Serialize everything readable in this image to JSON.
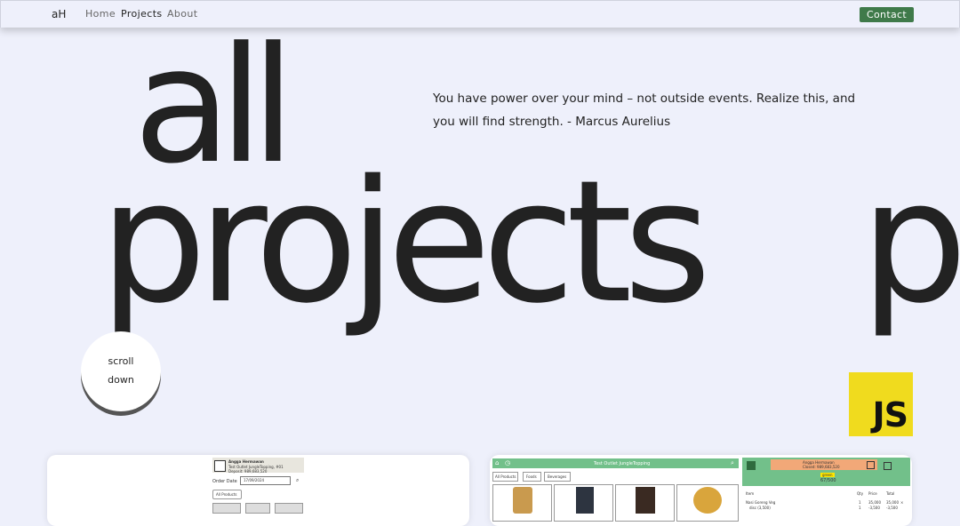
{
  "nav": {
    "logo": "aH",
    "links": [
      {
        "label": "Home",
        "active": false
      },
      {
        "label": "Projects",
        "active": true
      },
      {
        "label": "About",
        "active": false
      }
    ],
    "contact_label": "Contact",
    "contact_color": "#3f7a4a"
  },
  "hero": {
    "word_all": "all",
    "word_projects": "projects",
    "word_partial": "p",
    "quote": "You have power over your mind – not outside events. Realize this, and you will find strength. - Marcus Aurelius"
  },
  "scroll": {
    "line1": "scroll",
    "line2": "down"
  },
  "tech_badge": {
    "label": "JS",
    "color": "#f0db1e",
    "icon": "javascript-logo-icon"
  },
  "project1": {
    "user_name": "Angga Hermawan",
    "user_sub": "Test Outlet JungleTopping, #01",
    "user_deposit": "Deposit: 989,683,520",
    "order_date_label": "Order Date",
    "order_date_value": "17/09/2024",
    "all_products": "All Products"
  },
  "project2": {
    "header_title": "Test Outlet JungleTopping",
    "tabs": [
      "All Products",
      "Foods",
      "Beverages"
    ],
    "user_name": "Angga Hermawan",
    "user_sub": "Closed: 989,683,520",
    "badge": "green",
    "count": "67/500",
    "cols": [
      "Item",
      "Qty",
      "Price",
      "Total"
    ],
    "rows": [
      [
        "Nasi Goreng Veg",
        "1",
        "35,000",
        "35,000"
      ],
      [
        "disc (3,500)",
        "1",
        "-3,500",
        "-3,500"
      ]
    ],
    "header_color": "#72c08a",
    "orange_color": "#f2a878"
  }
}
